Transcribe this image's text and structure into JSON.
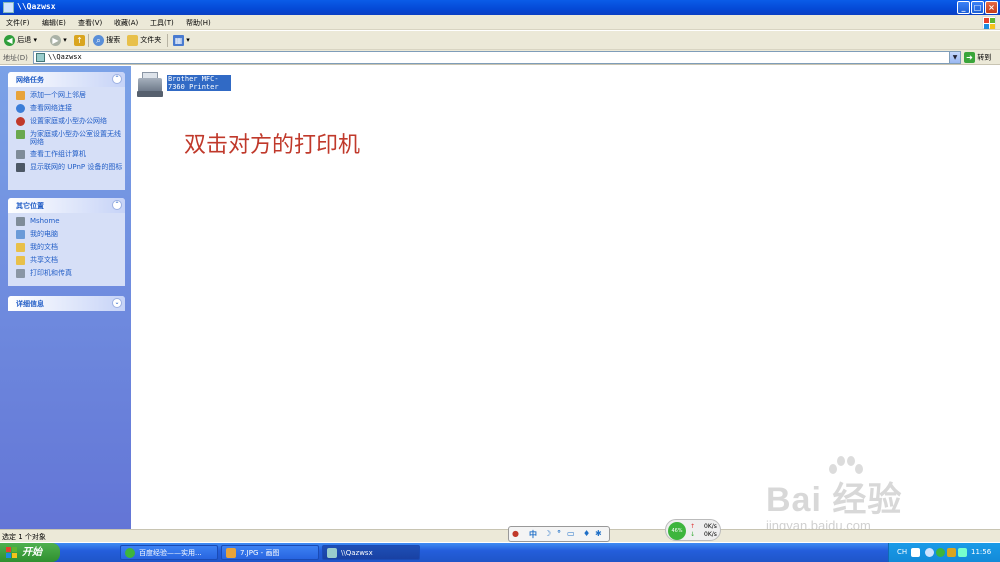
{
  "window": {
    "title": "\\\\Qazwsx"
  },
  "menu": [
    "文件(F)",
    "编辑(E)",
    "查看(V)",
    "收藏(A)",
    "工具(T)",
    "帮助(H)"
  ],
  "toolbar": {
    "back": "后退",
    "search": "搜索",
    "folders": "文件夹"
  },
  "address": {
    "label": "地址(D)",
    "value": "\\\\Qazwsx",
    "go": "转到"
  },
  "sidebar": {
    "network_tasks": {
      "title": "网络任务",
      "items": [
        "添加一个网上邻居",
        "查看网络连接",
        "设置家庭或小型办公网络",
        "为家庭或小型办公室设置无线网络",
        "查看工作组计算机",
        "显示联网的 UPnP 设备的图标"
      ]
    },
    "other_places": {
      "title": "其它位置",
      "items": [
        "Mshome",
        "我的电脑",
        "我的文档",
        "共享文档",
        "打印机和传真"
      ]
    },
    "details": {
      "title": "详细信息"
    }
  },
  "main": {
    "printer_label": "Brother MFC-7360 Printer",
    "annotation": "双击对方的打印机"
  },
  "watermark": {
    "brand": "Bai 经验",
    "url": "jingyan.baidu.com"
  },
  "status": {
    "text": "选定 1 个对象"
  },
  "ime": {
    "mode": "中"
  },
  "netmon": {
    "percent": "46%",
    "up": "0K/s",
    "down": "0K/s"
  },
  "taskbar": {
    "start": "开始",
    "tasks": [
      "百度经验——实用...",
      "7.JPG - 画图",
      "\\\\Qazwsx"
    ],
    "tray_lang": "CH",
    "clock": "11:56"
  },
  "colors": {
    "annotation": "#c0392b",
    "selection": "#316ac5",
    "taskbar": "#245edb"
  }
}
